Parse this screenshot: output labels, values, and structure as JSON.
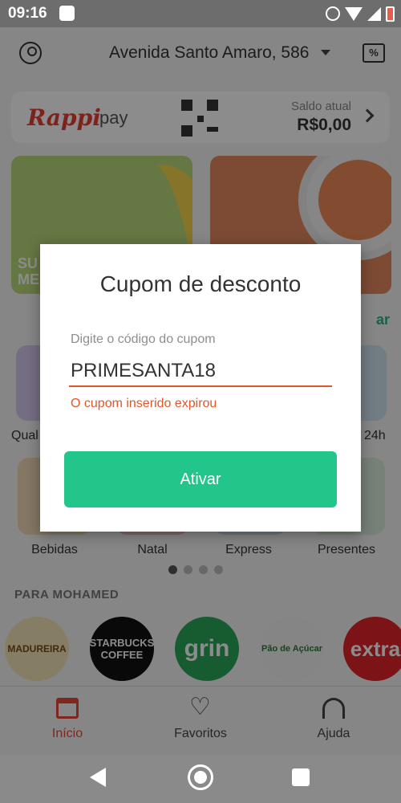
{
  "status_bar": {
    "time": "09:16"
  },
  "header": {
    "address": "Avenida Santo Amaro, 586",
    "coupon_icon": "%"
  },
  "rappi_pay": {
    "logo": "Rappi",
    "label": "pay",
    "saldo_label": "Saldo atual",
    "saldo_value": "R$0,00"
  },
  "banners": [
    {
      "text": "SU\nME"
    },
    {
      "text": ""
    }
  ],
  "see_more": "ar",
  "categories": [
    {
      "label": "Qual"
    },
    {
      "label": "24h"
    }
  ],
  "products": [
    {
      "label": "Bebidas"
    },
    {
      "label": "Natal"
    },
    {
      "label": "Express"
    },
    {
      "label": "Presentes"
    }
  ],
  "carousel": {
    "pages": 4,
    "active": 0
  },
  "section_title": "PARA MOHAMED",
  "stores": [
    {
      "name": "MADUREIRA"
    },
    {
      "name": "STARBUCKS COFFEE"
    },
    {
      "name": "grin"
    },
    {
      "name": "Pão de Açúcar"
    },
    {
      "name": "extra"
    }
  ],
  "tabbar": {
    "items": [
      {
        "label": "Início",
        "active": true
      },
      {
        "label": "Favoritos"
      },
      {
        "label": "Ajuda"
      }
    ]
  },
  "dialog": {
    "title": "Cupom de desconto",
    "field_label": "Digite o código do cupom",
    "field_value": "PRIMESANTA18",
    "error": "O cupom inserido expirou",
    "button": "Ativar"
  },
  "colors": {
    "accent": "#22c68a",
    "error": "#e0562b",
    "brand": "#ea3e34"
  }
}
